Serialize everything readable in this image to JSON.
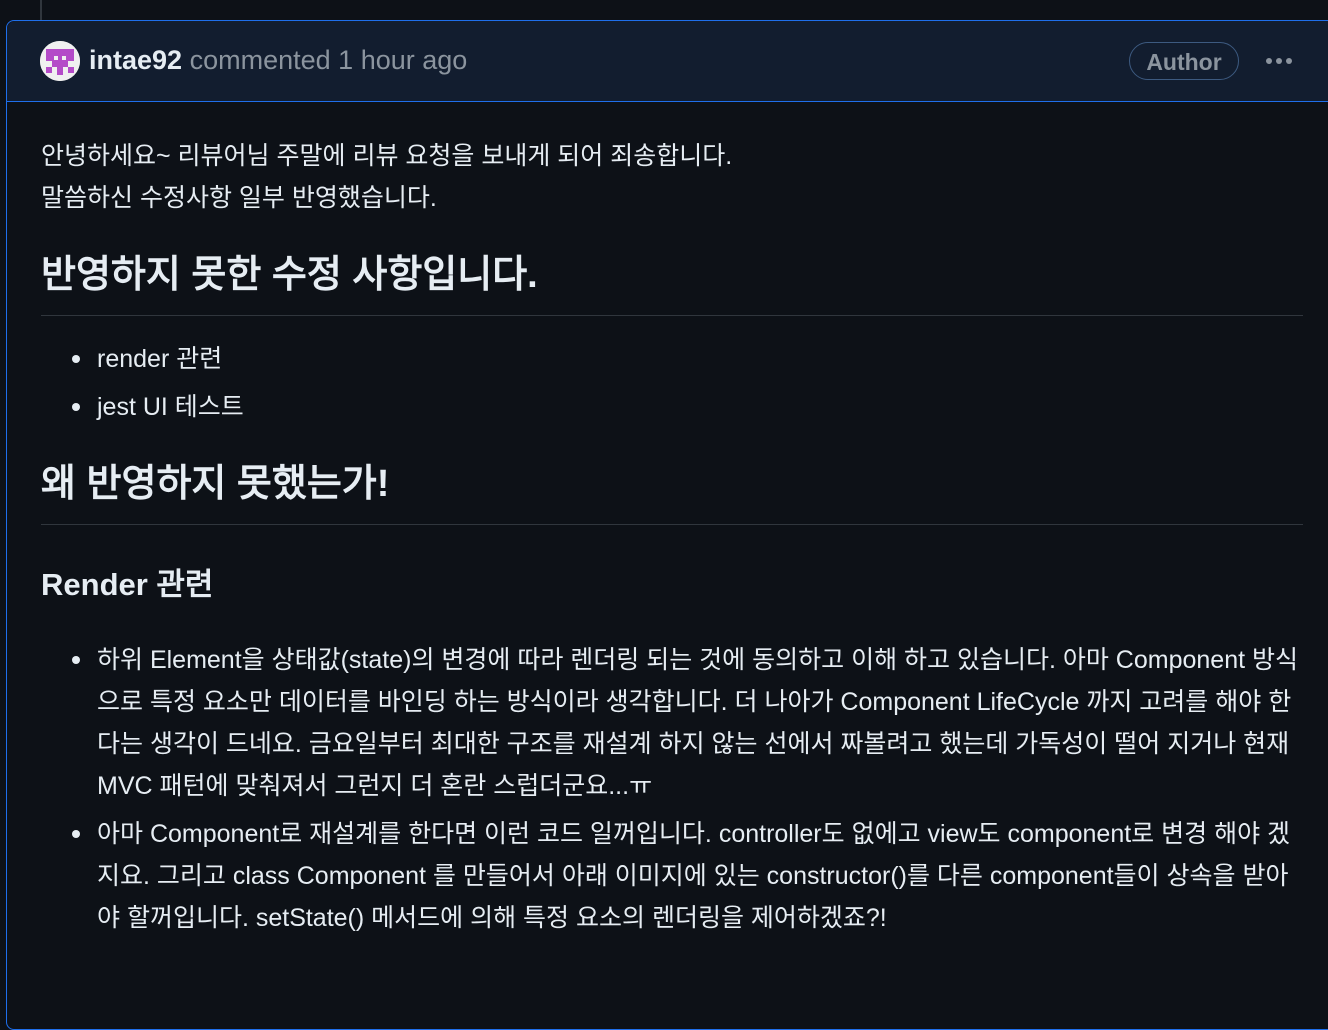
{
  "comment": {
    "author": "intae92",
    "action": "commented",
    "time": "1 hour ago",
    "badge": "Author",
    "menu_icon": "kebab-horizontal-icon"
  },
  "body": {
    "intro": [
      "안녕하세요~ 리뷰어님 주말에 리뷰 요청을 보내게 되어 죄송합니다.",
      "말씀하신 수정사항 일부 반영했습니다."
    ],
    "heading1": "반영하지 못한 수정 사항입니다.",
    "list1": [
      "render 관련",
      "jest UI 테스트"
    ],
    "heading2": "왜 반영하지 못했는가!",
    "heading3": "Render 관련",
    "list2": [
      "하위 Element을 상태값(state)의 변경에 따라 렌더링 되는 것에 동의하고 이해 하고 있습니다. 아마 Component 방식으로 특정 요소만 데이터를 바인딩 하는 방식이라 생각합니다. 더 나아가 Component LifeCycle 까지 고려를 해야 한다는 생각이 드네요. 금요일부터 최대한 구조를 재설계 하지 않는 선에서 짜볼려고 했는데 가독성이 떨어 지거나 현재 MVC 패턴에 맞춰져서 그런지 더 혼란 스럽더군요...ㅠ",
      "아마 Component로 재설계를 한다면 이런 코드 일꺼입니다. controller도 없에고 view도 component로 변경 해야 겠지요. 그리고 class Component 를 만들어서 아래 이미지에 있는 constructor()를 다른 component들이 상속을 받아야 할꺼입니다. setState() 메서드에 의해 특정 요소의 렌더링을 제어하겠죠?!"
    ]
  }
}
